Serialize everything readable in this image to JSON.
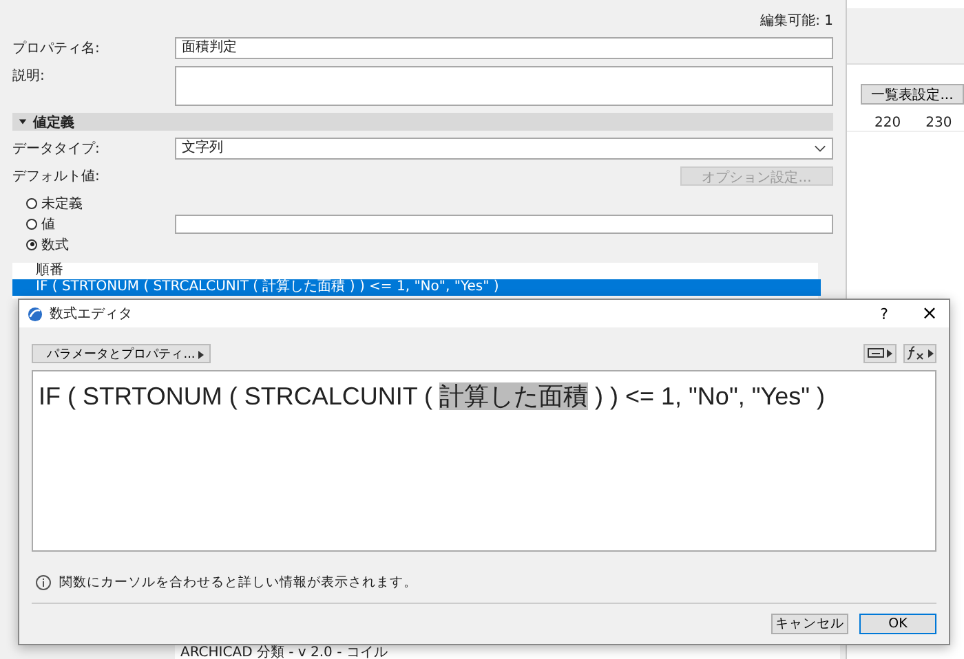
{
  "editable": "編集可能: 1",
  "fields": {
    "name_label": "プロパティ名:",
    "name_value": "面積判定",
    "desc_label": "説明:"
  },
  "section": {
    "title": "値定義",
    "expanded": true
  },
  "datatype": {
    "label": "データタイプ:",
    "value": "文字列"
  },
  "default": {
    "label": "デフォルト値:",
    "option_button": "オプション設定...",
    "option_disabled": true
  },
  "radios": [
    {
      "label": "未定義",
      "selected": false
    },
    {
      "label": "値",
      "selected": false
    },
    {
      "label": "数式",
      "selected": true
    }
  ],
  "list": {
    "header": "順番",
    "rows": [
      {
        "text": "IF ( STRTONUM ( STRCALCUNIT ( 計算した面積 ) ) <= 1, \"No\", \"Yes\" )",
        "selected": true
      }
    ]
  },
  "behind_text": "ARCHICAD 分類 - v 2.0 - コイル",
  "side": {
    "button": "一覧表設定...",
    "ruler": [
      "220",
      "230"
    ]
  },
  "dialog": {
    "title": "数式エディタ",
    "help": "?",
    "close": "×",
    "param_button": "パラメータとプロパティ...",
    "formula": {
      "before": "IF ( STRTONUM ( STRCALCUNIT ( ",
      "selection": "計算した面積",
      "after": " ) ) <= 1, \"No\", \"Yes\" )"
    },
    "info": "関数にカーソルを合わせると詳しい情報が表示されます。",
    "buttons": [
      {
        "label": "キャンセル",
        "default": false
      },
      {
        "label": "OK",
        "default": true
      }
    ]
  }
}
